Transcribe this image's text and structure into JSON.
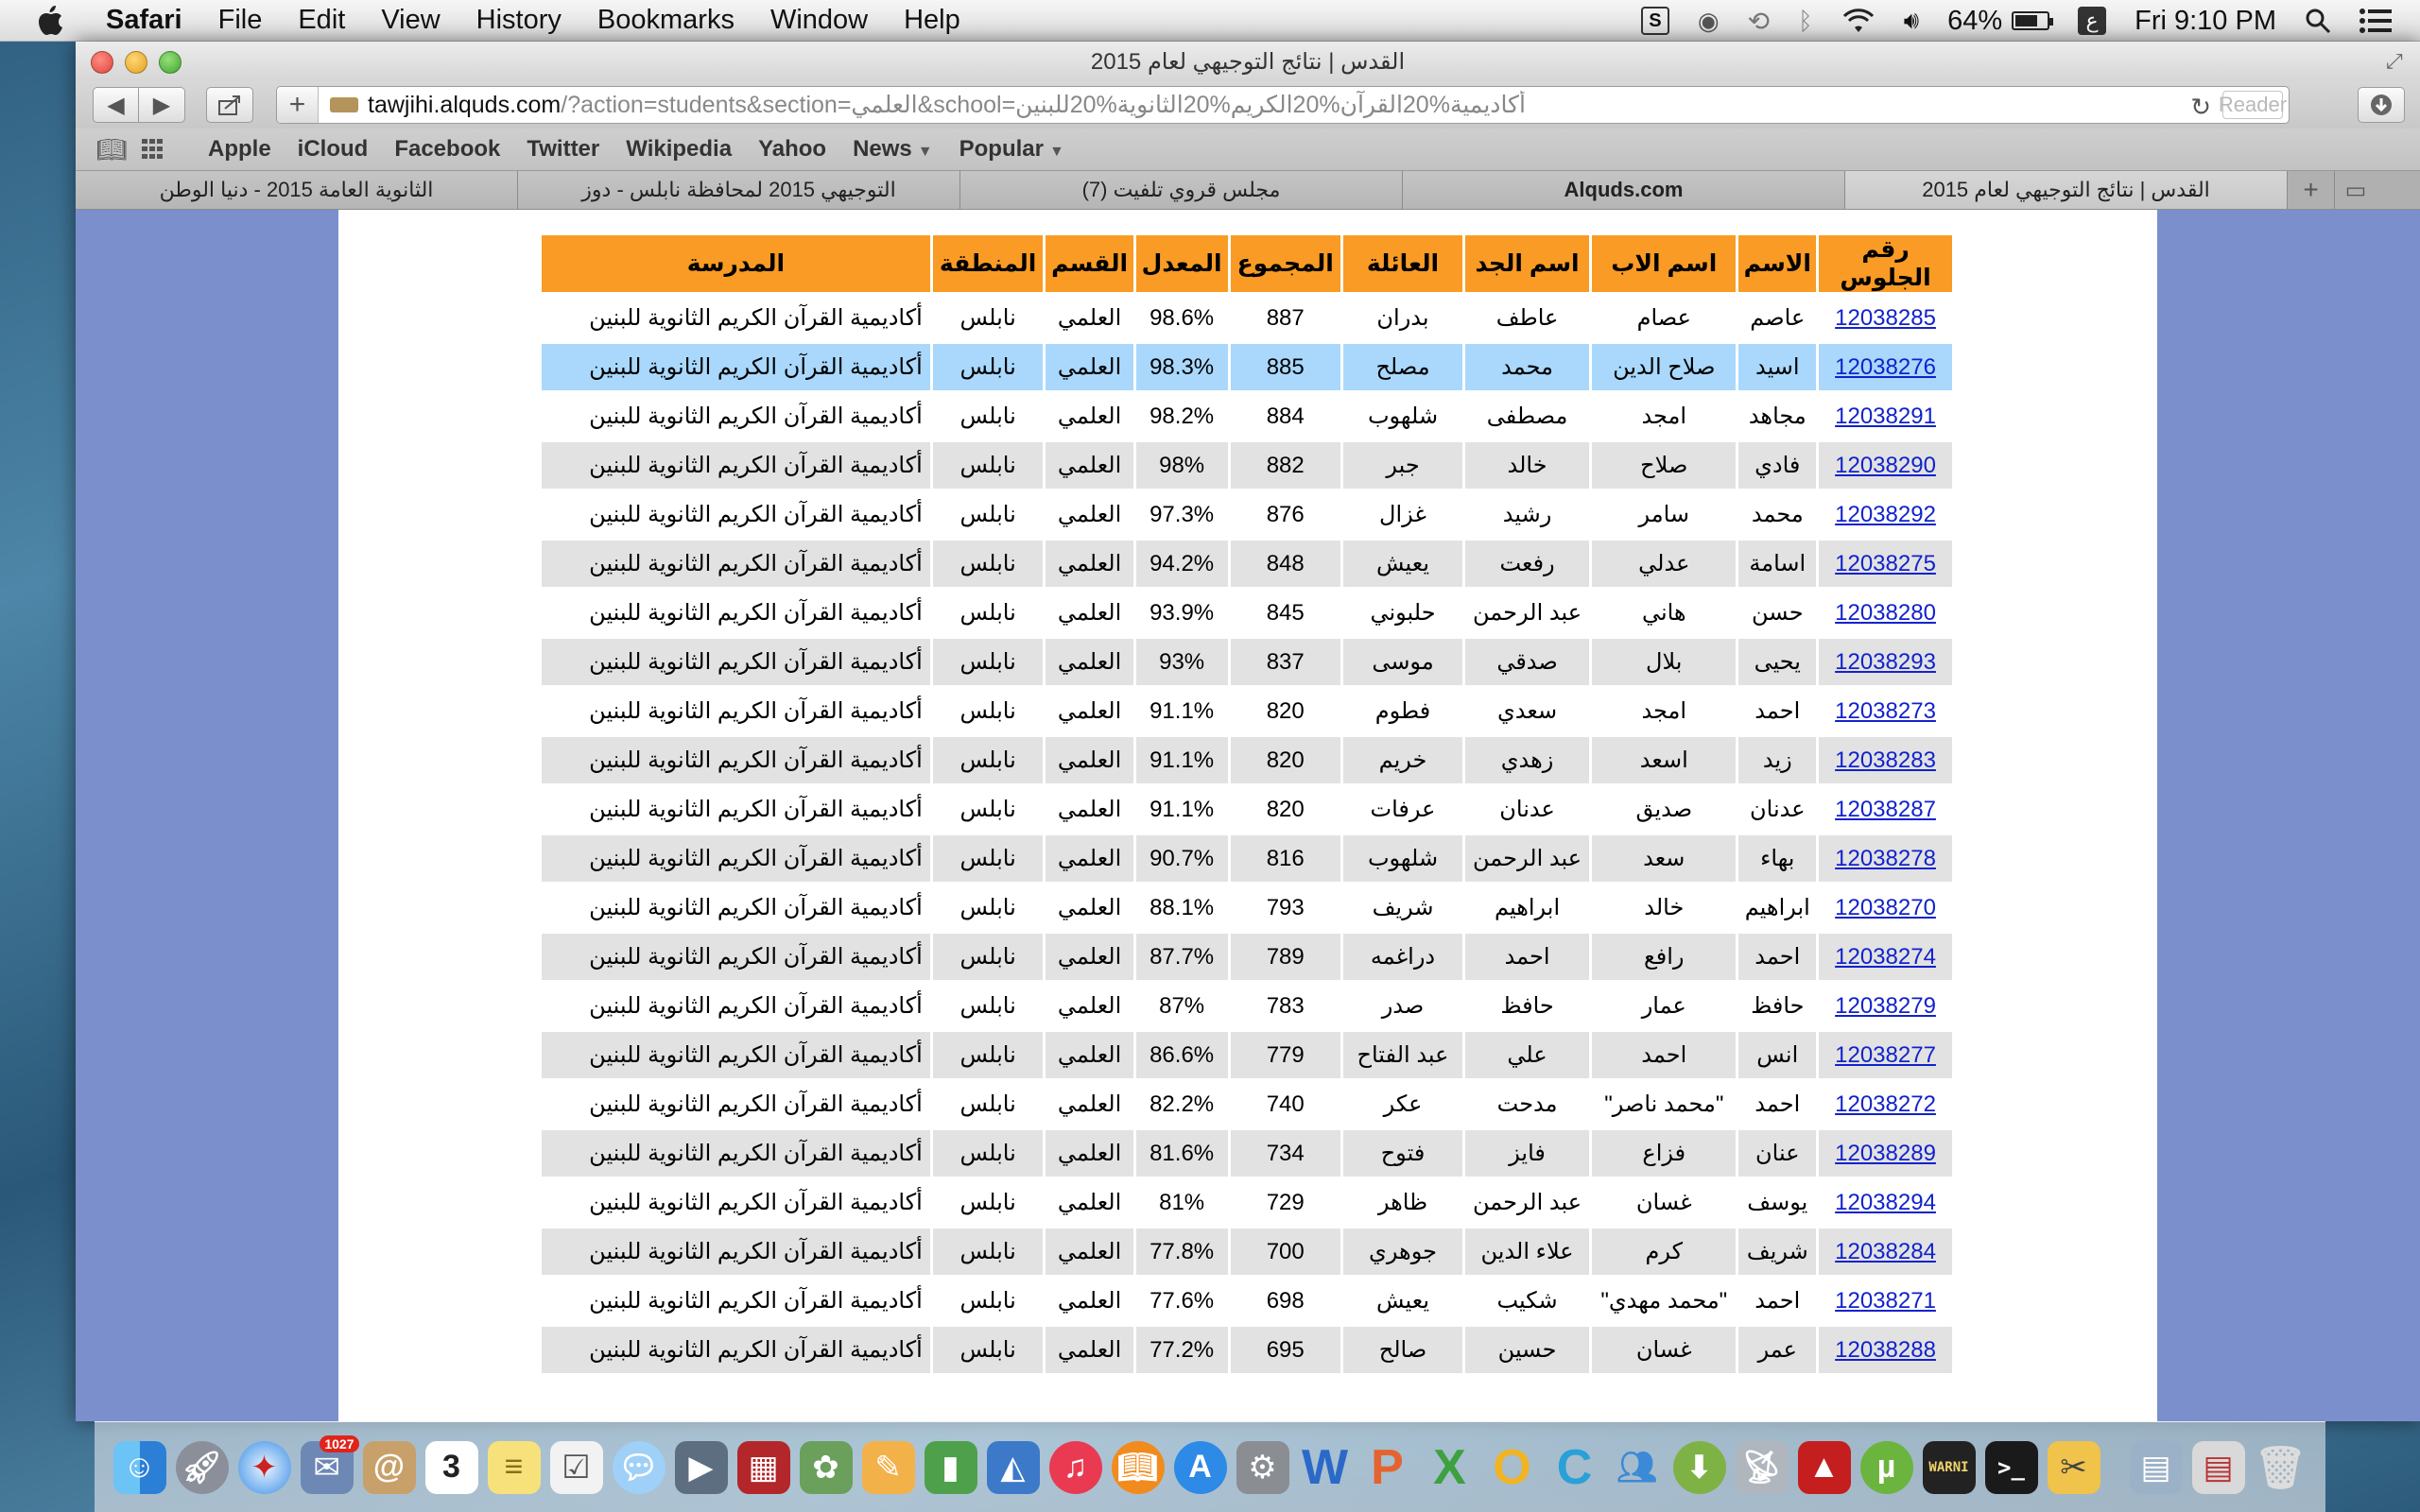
{
  "menubar": {
    "app_name": "Safari",
    "items": [
      "File",
      "Edit",
      "View",
      "History",
      "Bookmarks",
      "Window",
      "Help"
    ],
    "battery": "64%",
    "input_source": "ع",
    "clock": "Fri 9:10 PM"
  },
  "window": {
    "title": "القدس | نتائج التوجيهي لعام 2015"
  },
  "toolbar": {
    "url_domain": "tawjihi.alquds.com",
    "url_path": "/?action=students&section=العلمي&school=أكاديمية%20القرآن%20الكريم%20الثانوية%20للبنين",
    "reader_label": "Reader"
  },
  "bookmarks": [
    "Apple",
    "iCloud",
    "Facebook",
    "Twitter",
    "Wikipedia",
    "Yahoo",
    "News",
    "Popular"
  ],
  "tabs": [
    "الثانوية العامة 2015 - دنيا الوطن",
    "التوجيهي 2015 لمحافظة نابلس - دوز",
    "(7) مجلس قروي تلفيت",
    "Alquds.com",
    "القدس | نتائج التوجيهي لعام 2015"
  ],
  "table": {
    "headers": [
      "رقم الجلوس",
      "الاسم",
      "اسم الاب",
      "اسم الجد",
      "العائلة",
      "المجموع",
      "المعدل",
      "القسم",
      "المنطقة",
      "المدرسة"
    ],
    "rows": [
      [
        "12038285",
        "عاصم",
        "عصام",
        "عاطف",
        "بدران",
        "887",
        "98.6%",
        "العلمي",
        "نابلس",
        "أكاديمية القرآن الكريم الثانوية للبنين"
      ],
      [
        "12038276",
        "اسيد",
        "صلاح الدين",
        "محمد",
        "مصلح",
        "885",
        "98.3%",
        "العلمي",
        "نابلس",
        "أكاديمية القرآن الكريم الثانوية للبنين"
      ],
      [
        "12038291",
        "مجاهد",
        "امجد",
        "مصطفى",
        "شلهوب",
        "884",
        "98.2%",
        "العلمي",
        "نابلس",
        "أكاديمية القرآن الكريم الثانوية للبنين"
      ],
      [
        "12038290",
        "فادي",
        "صلاح",
        "خالد",
        "جبر",
        "882",
        "98%",
        "العلمي",
        "نابلس",
        "أكاديمية القرآن الكريم الثانوية للبنين"
      ],
      [
        "12038292",
        "محمد",
        "سامر",
        "رشيد",
        "غزال",
        "876",
        "97.3%",
        "العلمي",
        "نابلس",
        "أكاديمية القرآن الكريم الثانوية للبنين"
      ],
      [
        "12038275",
        "اسامة",
        "عدلي",
        "رفعت",
        "يعيش",
        "848",
        "94.2%",
        "العلمي",
        "نابلس",
        "أكاديمية القرآن الكريم الثانوية للبنين"
      ],
      [
        "12038280",
        "حسن",
        "هاني",
        "عبد الرحمن",
        "حلبوني",
        "845",
        "93.9%",
        "العلمي",
        "نابلس",
        "أكاديمية القرآن الكريم الثانوية للبنين"
      ],
      [
        "12038293",
        "يحيى",
        "بلال",
        "صدقي",
        "موسى",
        "837",
        "93%",
        "العلمي",
        "نابلس",
        "أكاديمية القرآن الكريم الثانوية للبنين"
      ],
      [
        "12038273",
        "احمد",
        "امجد",
        "سعدي",
        "فطوم",
        "820",
        "91.1%",
        "العلمي",
        "نابلس",
        "أكاديمية القرآن الكريم الثانوية للبنين"
      ],
      [
        "12038283",
        "زيد",
        "اسعد",
        "زهدي",
        "خريم",
        "820",
        "91.1%",
        "العلمي",
        "نابلس",
        "أكاديمية القرآن الكريم الثانوية للبنين"
      ],
      [
        "12038287",
        "عدنان",
        "صديق",
        "عدنان",
        "عرفات",
        "820",
        "91.1%",
        "العلمي",
        "نابلس",
        "أكاديمية القرآن الكريم الثانوية للبنين"
      ],
      [
        "12038278",
        "بهاء",
        "سعد",
        "عبد الرحمن",
        "شلهوب",
        "816",
        "90.7%",
        "العلمي",
        "نابلس",
        "أكاديمية القرآن الكريم الثانوية للبنين"
      ],
      [
        "12038270",
        "ابراهيم",
        "خالد",
        "ابراهيم",
        "شريف",
        "793",
        "88.1%",
        "العلمي",
        "نابلس",
        "أكاديمية القرآن الكريم الثانوية للبنين"
      ],
      [
        "12038274",
        "احمد",
        "رافع",
        "احمد",
        "دراغمه",
        "789",
        "87.7%",
        "العلمي",
        "نابلس",
        "أكاديمية القرآن الكريم الثانوية للبنين"
      ],
      [
        "12038279",
        "حافظ",
        "عمار",
        "حافظ",
        "صدر",
        "783",
        "87%",
        "العلمي",
        "نابلس",
        "أكاديمية القرآن الكريم الثانوية للبنين"
      ],
      [
        "12038277",
        "انس",
        "احمد",
        "علي",
        "عبد الفتاح",
        "779",
        "86.6%",
        "العلمي",
        "نابلس",
        "أكاديمية القرآن الكريم الثانوية للبنين"
      ],
      [
        "12038272",
        "احمد",
        "\"محمد ناصر\"",
        "مدحت",
        "عكر",
        "740",
        "82.2%",
        "العلمي",
        "نابلس",
        "أكاديمية القرآن الكريم الثانوية للبنين"
      ],
      [
        "12038289",
        "عنان",
        "فزاع",
        "فايز",
        "فتوح",
        "734",
        "81.6%",
        "العلمي",
        "نابلس",
        "أكاديمية القرآن الكريم الثانوية للبنين"
      ],
      [
        "12038294",
        "يوسف",
        "غسان",
        "عبد الرحمن",
        "ظاهر",
        "729",
        "81%",
        "العلمي",
        "نابلس",
        "أكاديمية القرآن الكريم الثانوية للبنين"
      ],
      [
        "12038284",
        "شريف",
        "كرم",
        "علاء الدين",
        "جوهري",
        "700",
        "77.8%",
        "العلمي",
        "نابلس",
        "أكاديمية القرآن الكريم الثانوية للبنين"
      ],
      [
        "12038271",
        "احمد",
        "\"محمد مهدي\"",
        "شكيب",
        "يعيش",
        "698",
        "77.6%",
        "العلمي",
        "نابلس",
        "أكاديمية القرآن الكريم الثانوية للبنين"
      ],
      [
        "12038288",
        "عمر",
        "غسان",
        "حسين",
        "صالح",
        "695",
        "77.2%",
        "العلمي",
        "نابلس",
        "أكاديمية القرآن الكريم الثانوية للبنين"
      ]
    ],
    "highlighted_row": 1
  },
  "dock": {
    "calendar_day": "3",
    "badge": "1027",
    "console_label": "WARNI"
  },
  "colors": {
    "header_bg": "#f99b24",
    "row_gray": "#e2e2e2",
    "row_highlight": "#a9d8fc",
    "link": "#1122cc",
    "page_side_bg": "#7b8fcc"
  }
}
